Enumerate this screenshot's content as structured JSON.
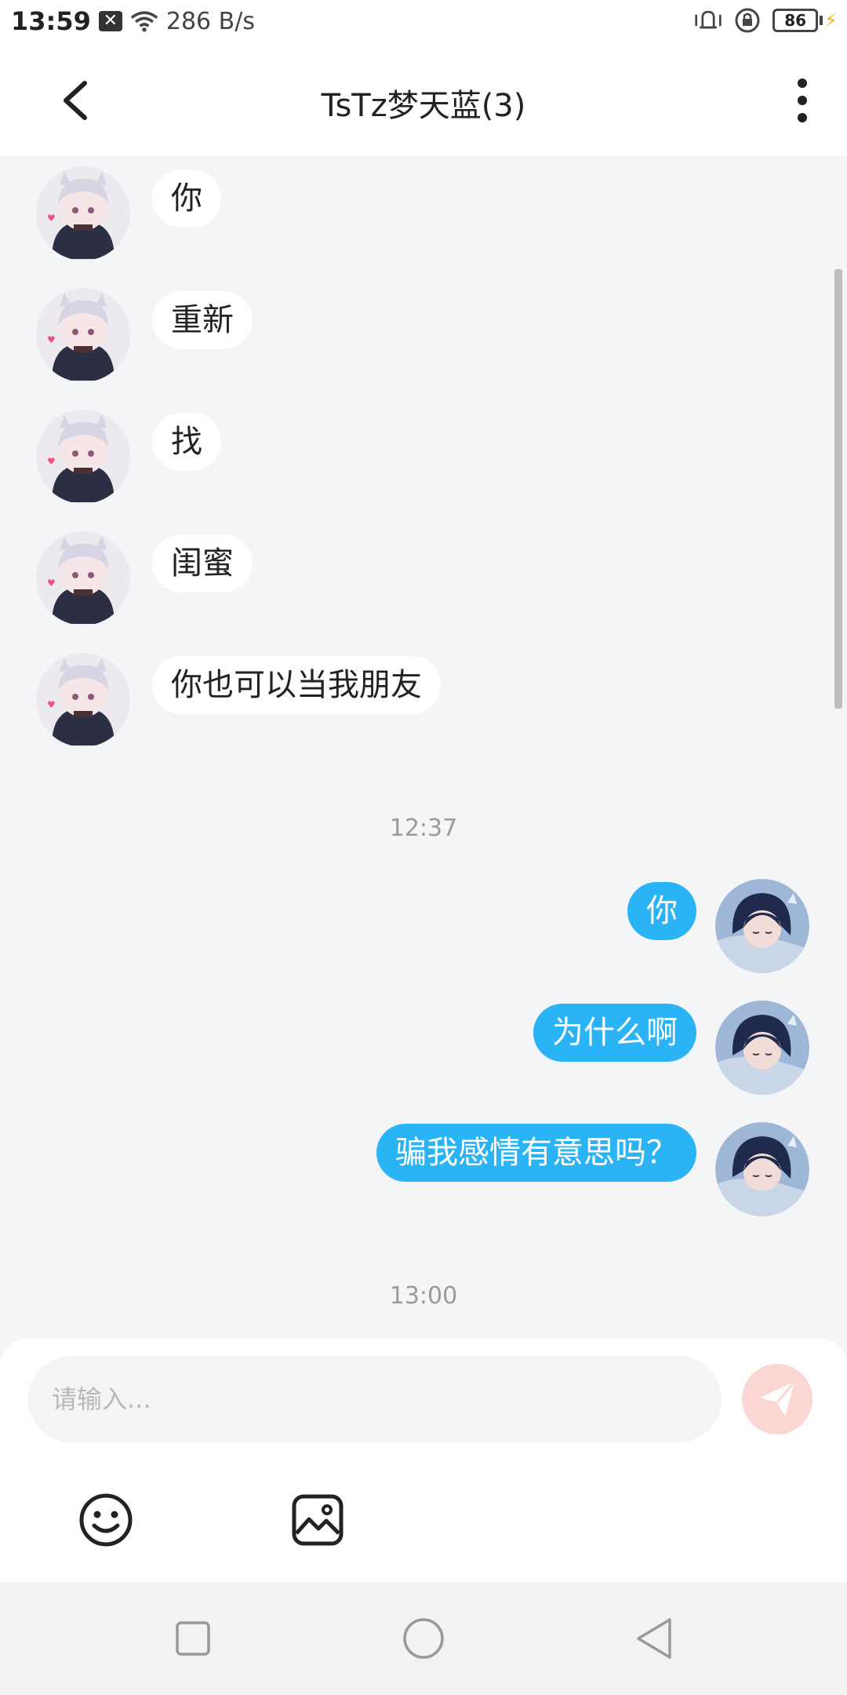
{
  "status_bar": {
    "time": "13:59",
    "notification_icon": "x-badge-icon",
    "net_speed": "286 B/s",
    "battery": "86"
  },
  "header": {
    "title": "TsTz梦天蓝(3)",
    "back_icon": "chevron-left-icon",
    "more_icon": "more-vertical-icon"
  },
  "messages_in": [
    {
      "text": "你"
    },
    {
      "text": "重新"
    },
    {
      "text": "找"
    },
    {
      "text": "闺蜜"
    },
    {
      "text": "你也可以当我朋友"
    }
  ],
  "time_separators": [
    "12:37",
    "13:00"
  ],
  "messages_out": [
    {
      "text": "你"
    },
    {
      "text": "为什么啊"
    },
    {
      "text": "骗我感情有意思吗？"
    }
  ],
  "composer": {
    "placeholder": "请输入...",
    "send_icon": "send-icon",
    "emoji_icon": "emoji-icon",
    "image_icon": "image-icon"
  },
  "colors": {
    "outgoing_bubble": "#2bb4f5",
    "incoming_bubble": "#ffffff",
    "background": "#f4f5f7",
    "send_button": "#fbd7d3"
  }
}
